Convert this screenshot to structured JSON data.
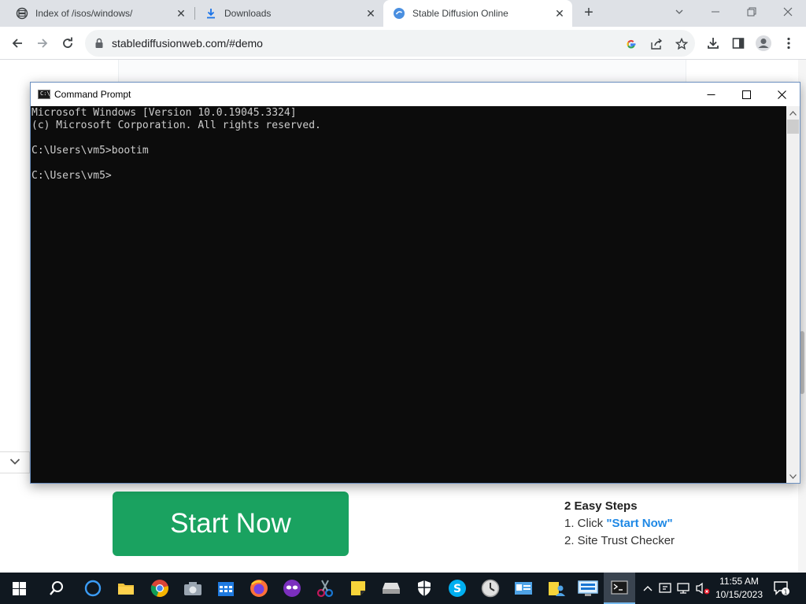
{
  "browser": {
    "tabs": [
      {
        "title": "Index of /isos/windows/",
        "icon": "server-icon",
        "active": false
      },
      {
        "title": "Downloads",
        "icon": "download-icon",
        "active": false
      },
      {
        "title": "Stable Diffusion Online",
        "icon": "stable-diffusion-icon",
        "active": true
      }
    ],
    "url": "stablediffusionweb.com/#demo"
  },
  "page": {
    "start_button": "Start Now",
    "steps_title": "2 Easy Steps",
    "step1_prefix": "1. Click ",
    "step1_link": "\"Start Now\"",
    "step2": "2. Site Trust Checker"
  },
  "cmd": {
    "title": "Command Prompt",
    "icon_label": "C:\\_",
    "lines": [
      "Microsoft Windows [Version 10.0.19045.3324]",
      "(c) Microsoft Corporation. All rights reserved.",
      "",
      "C:\\Users\\vm5>bootim",
      "",
      "C:\\Users\\vm5>"
    ]
  },
  "taskbar": {
    "time": "11:55 AM",
    "date": "10/15/2023",
    "notification_count": "1"
  },
  "colors": {
    "start_button": "#1aa260",
    "step_link": "#1e88e5",
    "cmd_background": "#0c0c0c",
    "taskbar": "#101820"
  }
}
